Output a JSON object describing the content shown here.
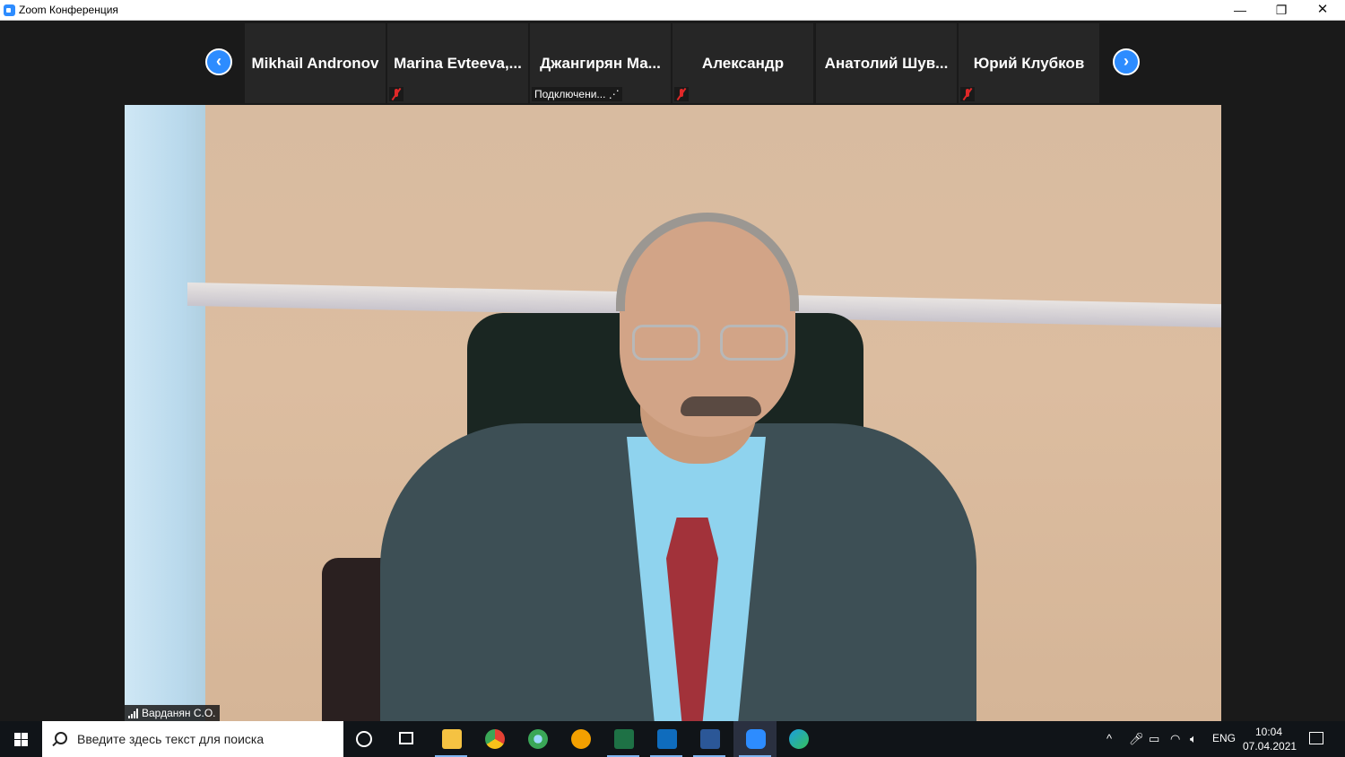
{
  "window": {
    "title": "Zoom Конференция",
    "minimize_glyph": "—",
    "restore_glyph": "❐",
    "close_glyph": "✕"
  },
  "participants_strip": {
    "prev_glyph": "‹",
    "next_glyph": "›",
    "tiles": [
      {
        "name": "Mikhail Andronov",
        "muted": false,
        "status": ""
      },
      {
        "name": "Marina  Evteeva,...",
        "muted": true,
        "status": ""
      },
      {
        "name": "Джангирян  Ма...",
        "muted": false,
        "status": "Подключени...  ⋰"
      },
      {
        "name": "Александр",
        "muted": true,
        "status": ""
      },
      {
        "name": "Анатолий  Шув...",
        "muted": false,
        "status": ""
      },
      {
        "name": "Юрий Клубков",
        "muted": true,
        "status": ""
      }
    ]
  },
  "active_speaker": {
    "name": "Варданян С.О."
  },
  "taskbar": {
    "search_placeholder": "Введите здесь текст для поиска",
    "apps": [
      {
        "icon": "file-explorer-icon",
        "color": "#f5c242"
      },
      {
        "icon": "chrome-icon",
        "color": "#e44134"
      },
      {
        "icon": "globe-app-icon",
        "color": "#3aa757"
      },
      {
        "icon": "1c-icon",
        "color": "#f4a000"
      },
      {
        "icon": "excel-icon",
        "color": "#1e7145"
      },
      {
        "icon": "outlook-icon",
        "color": "#0f6cbd"
      },
      {
        "icon": "word-icon",
        "color": "#2b5797"
      },
      {
        "icon": "zoom-icon",
        "color": "#2d8cff"
      },
      {
        "icon": "edge-icon",
        "color": "#1b9de2"
      }
    ],
    "tray": {
      "chevron": "^",
      "language": "ENG",
      "time": "10:04",
      "date": "07.04.2021"
    }
  }
}
